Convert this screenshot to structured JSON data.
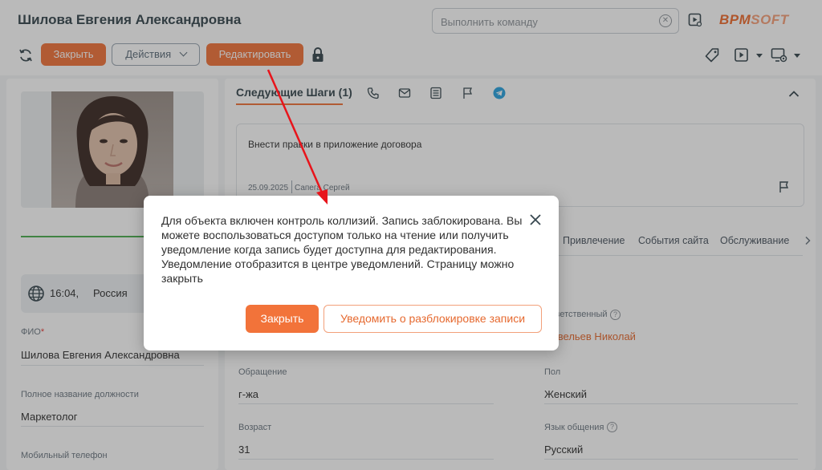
{
  "header": {
    "title": "Шилова Евгения Александровна",
    "command_placeholder": "Выполнить команду",
    "logo_part1": "BPM",
    "logo_part2": "SOFT"
  },
  "toolbar": {
    "close_label": "Закрыть",
    "actions_label": "Действия",
    "edit_label": "Редактировать"
  },
  "left": {
    "timezone_time": "16:04,",
    "timezone_country": "Россия",
    "fields": [
      {
        "label": "ФИО",
        "required": "*",
        "value": "Шилова Евгения Александровна"
      },
      {
        "label": "Полное название должности",
        "value": "Маркетолог"
      },
      {
        "label": "Мобильный телефон",
        "value": ""
      }
    ]
  },
  "right": {
    "next_steps_tab": "Следующие Шаги (1)",
    "task": {
      "title": "Внести правки в приложение договора",
      "date": "25.09.2025",
      "author": "Сапега Сергей"
    },
    "tabs": [
      "Привлечение",
      "События сайта",
      "Обслуживание"
    ],
    "fields": {
      "responsible_label": "Ответственный",
      "responsible_value": "Савельев Николай",
      "salutation_label": "Обращение",
      "salutation_value": "г-жа",
      "gender_label": "Пол",
      "gender_value": "Женский",
      "age_label": "Возраст",
      "age_value": "31",
      "language_label": "Язык общения",
      "language_value": "Русский"
    }
  },
  "dialog": {
    "message": "Для объекта включен контроль коллизий. Запись заблокирована. Вы можете воспользоваться доступом только на чтение или получить уведомление когда запись будет доступна для редактирования. Уведомление отобразится в центре уведомлений. Страницу можно закрыть",
    "close_button": "Закрыть",
    "notify_button": "Уведомить о разблокировке записи"
  },
  "colors": {
    "accent": "#f2733a",
    "annotation_arrow": "#e8141b",
    "progress": "#4caf50"
  }
}
